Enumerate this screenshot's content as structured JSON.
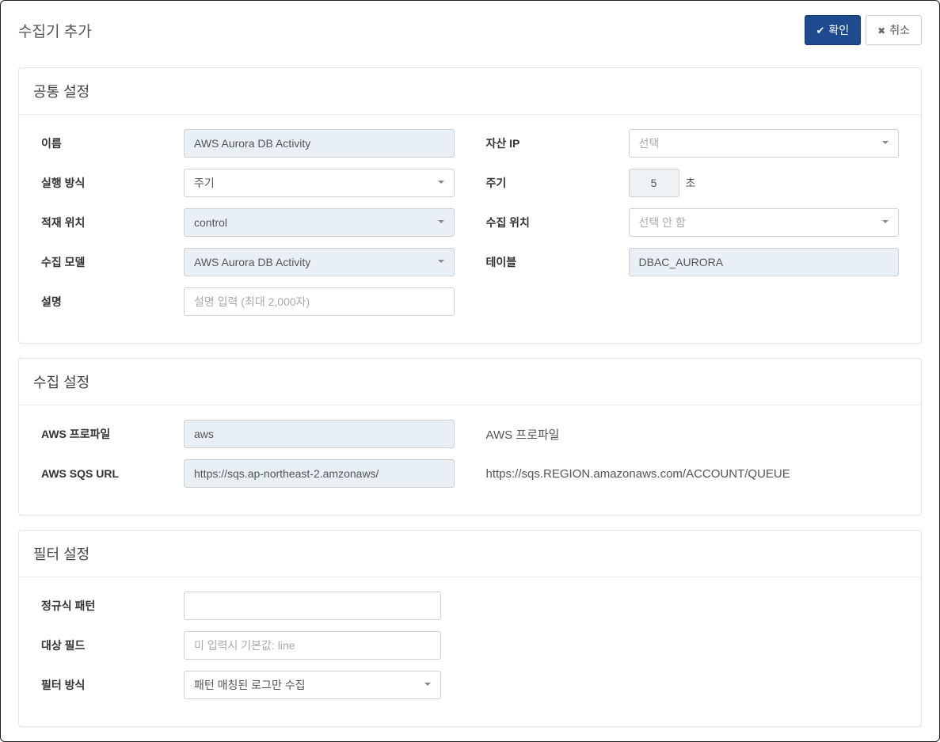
{
  "header": {
    "title": "수집기 추가",
    "confirm_label": "확인",
    "cancel_label": "취소"
  },
  "common_settings": {
    "heading": "공통 설정",
    "name_label": "이름",
    "name_value": "AWS Aurora DB Activity",
    "asset_ip_label": "자산 IP",
    "asset_ip_placeholder": "선택",
    "exec_mode_label": "실행 방식",
    "exec_mode_value": "주기",
    "period_label": "주기",
    "period_value": "5",
    "period_unit": "초",
    "load_location_label": "적재 위치",
    "load_location_value": "control",
    "collect_location_label": "수집 위치",
    "collect_location_placeholder": "선택 안 함",
    "collect_model_label": "수집 모델",
    "collect_model_value": "AWS Aurora DB Activity",
    "table_label": "테이블",
    "table_value": "DBAC_AURORA",
    "description_label": "설명",
    "description_placeholder": "설명 입력 (최대 2,000자)"
  },
  "collection_settings": {
    "heading": "수집 설정",
    "aws_profile_label": "AWS 프로파일",
    "aws_profile_value": "aws",
    "aws_profile_hint": "AWS 프로파일",
    "aws_sqs_label": "AWS SQS URL",
    "aws_sqs_value": "https://sqs.ap-northeast-2.amzonaws/",
    "aws_sqs_hint": "https://sqs.REGION.amazonaws.com/ACCOUNT/QUEUE"
  },
  "filter_settings": {
    "heading": "필터 설정",
    "regex_label": "정규식 패턴",
    "regex_value": "",
    "target_field_label": "대상 필드",
    "target_field_placeholder": "미 입력시 기본값: line",
    "filter_mode_label": "필터 방식",
    "filter_mode_value": "패턴 매칭된 로그만 수집"
  }
}
